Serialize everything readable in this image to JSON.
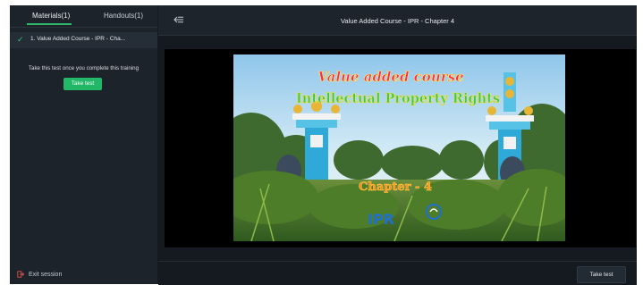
{
  "sidebar": {
    "tabs": [
      {
        "label": "Materials(1)"
      },
      {
        "label": "Handouts(1)"
      }
    ],
    "materials": [
      {
        "label": "1. Value Added Course - IPR - Cha..."
      }
    ],
    "note": "Take this test once you complete this training",
    "take_test_label": "Take test",
    "exit_label": "Exit session"
  },
  "header": {
    "title": "Value Added Course - IPR - Chapter 4"
  },
  "video": {
    "line1": "Value added course",
    "line2": "Intellectual Property Rights",
    "line3": "Chapter - 4",
    "logo": "IPR"
  },
  "footer": {
    "take_test_label": "Take test"
  },
  "colors": {
    "accent": "#22b868",
    "background": "#151a21",
    "sidebar": "#1c232b"
  }
}
